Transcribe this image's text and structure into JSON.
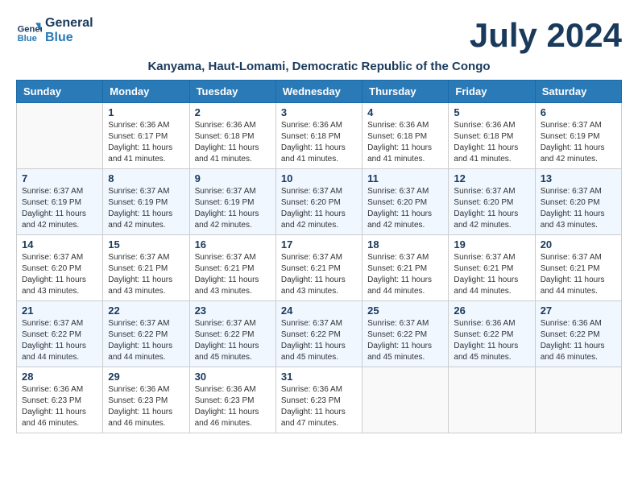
{
  "header": {
    "logo_line1": "General",
    "logo_line2": "Blue",
    "month_year": "July 2024",
    "subtitle": "Kanyama, Haut-Lomami, Democratic Republic of the Congo"
  },
  "weekdays": [
    "Sunday",
    "Monday",
    "Tuesday",
    "Wednesday",
    "Thursday",
    "Friday",
    "Saturday"
  ],
  "weeks": [
    [
      {
        "day": "",
        "sunrise": "",
        "sunset": "",
        "daylight": ""
      },
      {
        "day": "1",
        "sunrise": "Sunrise: 6:36 AM",
        "sunset": "Sunset: 6:17 PM",
        "daylight": "Daylight: 11 hours and 41 minutes."
      },
      {
        "day": "2",
        "sunrise": "Sunrise: 6:36 AM",
        "sunset": "Sunset: 6:18 PM",
        "daylight": "Daylight: 11 hours and 41 minutes."
      },
      {
        "day": "3",
        "sunrise": "Sunrise: 6:36 AM",
        "sunset": "Sunset: 6:18 PM",
        "daylight": "Daylight: 11 hours and 41 minutes."
      },
      {
        "day": "4",
        "sunrise": "Sunrise: 6:36 AM",
        "sunset": "Sunset: 6:18 PM",
        "daylight": "Daylight: 11 hours and 41 minutes."
      },
      {
        "day": "5",
        "sunrise": "Sunrise: 6:36 AM",
        "sunset": "Sunset: 6:18 PM",
        "daylight": "Daylight: 11 hours and 41 minutes."
      },
      {
        "day": "6",
        "sunrise": "Sunrise: 6:37 AM",
        "sunset": "Sunset: 6:19 PM",
        "daylight": "Daylight: 11 hours and 42 minutes."
      }
    ],
    [
      {
        "day": "7",
        "sunrise": "Sunrise: 6:37 AM",
        "sunset": "Sunset: 6:19 PM",
        "daylight": "Daylight: 11 hours and 42 minutes."
      },
      {
        "day": "8",
        "sunrise": "Sunrise: 6:37 AM",
        "sunset": "Sunset: 6:19 PM",
        "daylight": "Daylight: 11 hours and 42 minutes."
      },
      {
        "day": "9",
        "sunrise": "Sunrise: 6:37 AM",
        "sunset": "Sunset: 6:19 PM",
        "daylight": "Daylight: 11 hours and 42 minutes."
      },
      {
        "day": "10",
        "sunrise": "Sunrise: 6:37 AM",
        "sunset": "Sunset: 6:20 PM",
        "daylight": "Daylight: 11 hours and 42 minutes."
      },
      {
        "day": "11",
        "sunrise": "Sunrise: 6:37 AM",
        "sunset": "Sunset: 6:20 PM",
        "daylight": "Daylight: 11 hours and 42 minutes."
      },
      {
        "day": "12",
        "sunrise": "Sunrise: 6:37 AM",
        "sunset": "Sunset: 6:20 PM",
        "daylight": "Daylight: 11 hours and 42 minutes."
      },
      {
        "day": "13",
        "sunrise": "Sunrise: 6:37 AM",
        "sunset": "Sunset: 6:20 PM",
        "daylight": "Daylight: 11 hours and 43 minutes."
      }
    ],
    [
      {
        "day": "14",
        "sunrise": "Sunrise: 6:37 AM",
        "sunset": "Sunset: 6:20 PM",
        "daylight": "Daylight: 11 hours and 43 minutes."
      },
      {
        "day": "15",
        "sunrise": "Sunrise: 6:37 AM",
        "sunset": "Sunset: 6:21 PM",
        "daylight": "Daylight: 11 hours and 43 minutes."
      },
      {
        "day": "16",
        "sunrise": "Sunrise: 6:37 AM",
        "sunset": "Sunset: 6:21 PM",
        "daylight": "Daylight: 11 hours and 43 minutes."
      },
      {
        "day": "17",
        "sunrise": "Sunrise: 6:37 AM",
        "sunset": "Sunset: 6:21 PM",
        "daylight": "Daylight: 11 hours and 43 minutes."
      },
      {
        "day": "18",
        "sunrise": "Sunrise: 6:37 AM",
        "sunset": "Sunset: 6:21 PM",
        "daylight": "Daylight: 11 hours and 44 minutes."
      },
      {
        "day": "19",
        "sunrise": "Sunrise: 6:37 AM",
        "sunset": "Sunset: 6:21 PM",
        "daylight": "Daylight: 11 hours and 44 minutes."
      },
      {
        "day": "20",
        "sunrise": "Sunrise: 6:37 AM",
        "sunset": "Sunset: 6:21 PM",
        "daylight": "Daylight: 11 hours and 44 minutes."
      }
    ],
    [
      {
        "day": "21",
        "sunrise": "Sunrise: 6:37 AM",
        "sunset": "Sunset: 6:22 PM",
        "daylight": "Daylight: 11 hours and 44 minutes."
      },
      {
        "day": "22",
        "sunrise": "Sunrise: 6:37 AM",
        "sunset": "Sunset: 6:22 PM",
        "daylight": "Daylight: 11 hours and 44 minutes."
      },
      {
        "day": "23",
        "sunrise": "Sunrise: 6:37 AM",
        "sunset": "Sunset: 6:22 PM",
        "daylight": "Daylight: 11 hours and 45 minutes."
      },
      {
        "day": "24",
        "sunrise": "Sunrise: 6:37 AM",
        "sunset": "Sunset: 6:22 PM",
        "daylight": "Daylight: 11 hours and 45 minutes."
      },
      {
        "day": "25",
        "sunrise": "Sunrise: 6:37 AM",
        "sunset": "Sunset: 6:22 PM",
        "daylight": "Daylight: 11 hours and 45 minutes."
      },
      {
        "day": "26",
        "sunrise": "Sunrise: 6:36 AM",
        "sunset": "Sunset: 6:22 PM",
        "daylight": "Daylight: 11 hours and 45 minutes."
      },
      {
        "day": "27",
        "sunrise": "Sunrise: 6:36 AM",
        "sunset": "Sunset: 6:22 PM",
        "daylight": "Daylight: 11 hours and 46 minutes."
      }
    ],
    [
      {
        "day": "28",
        "sunrise": "Sunrise: 6:36 AM",
        "sunset": "Sunset: 6:23 PM",
        "daylight": "Daylight: 11 hours and 46 minutes."
      },
      {
        "day": "29",
        "sunrise": "Sunrise: 6:36 AM",
        "sunset": "Sunset: 6:23 PM",
        "daylight": "Daylight: 11 hours and 46 minutes."
      },
      {
        "day": "30",
        "sunrise": "Sunrise: 6:36 AM",
        "sunset": "Sunset: 6:23 PM",
        "daylight": "Daylight: 11 hours and 46 minutes."
      },
      {
        "day": "31",
        "sunrise": "Sunrise: 6:36 AM",
        "sunset": "Sunset: 6:23 PM",
        "daylight": "Daylight: 11 hours and 47 minutes."
      },
      {
        "day": "",
        "sunrise": "",
        "sunset": "",
        "daylight": ""
      },
      {
        "day": "",
        "sunrise": "",
        "sunset": "",
        "daylight": ""
      },
      {
        "day": "",
        "sunrise": "",
        "sunset": "",
        "daylight": ""
      }
    ]
  ]
}
